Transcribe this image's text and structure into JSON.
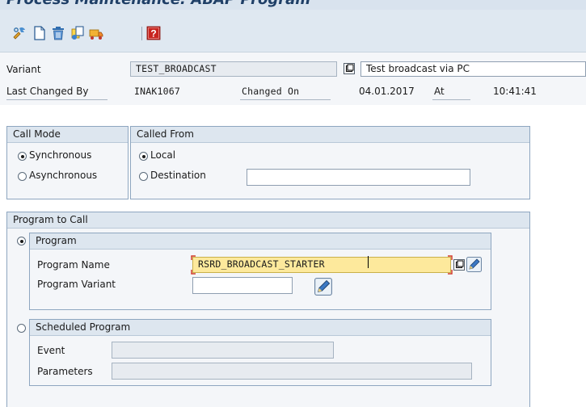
{
  "window": {
    "title": "Process Maintenance: ABAP Program"
  },
  "toolbar": {
    "icons": [
      "change-display-icon",
      "new-document-icon",
      "delete-icon",
      "copy-icon",
      "transport-icon",
      "help-icon"
    ]
  },
  "header": {
    "variant_label": "Variant",
    "variant_value": "TEST_BROADCAST",
    "variant_description": "Test broadcast via PC",
    "last_changed_by_label": "Last Changed By",
    "last_changed_by_value": "INAK1067",
    "changed_on_label": "Changed On",
    "changed_on_value": "04.01.2017",
    "at_label": "At",
    "at_value": "10:41:41"
  },
  "call_mode": {
    "title": "Call Mode",
    "options": [
      {
        "label": "Synchronous",
        "selected": true
      },
      {
        "label": "Asynchronous",
        "selected": false
      }
    ]
  },
  "called_from": {
    "title": "Called From",
    "options": [
      {
        "label": "Local",
        "selected": true
      },
      {
        "label": "Destination",
        "selected": false
      }
    ],
    "destination_value": ""
  },
  "program_to_call": {
    "title": "Program to Call",
    "program": {
      "title": "Program",
      "selected": true,
      "name_label": "Program Name",
      "name_value": "RSRD_BROADCAST_STARTER",
      "variant_label": "Program Variant",
      "variant_value": ""
    },
    "scheduled": {
      "title": "Scheduled Program",
      "selected": false,
      "event_label": "Event",
      "event_value": "",
      "parameters_label": "Parameters",
      "parameters_value": ""
    }
  },
  "colors": {
    "toolbar_bg": "#dfe8f1",
    "group_border": "#8ea6c0",
    "active_field_bg": "#fde99c",
    "required_marker": "#d23b2b"
  }
}
